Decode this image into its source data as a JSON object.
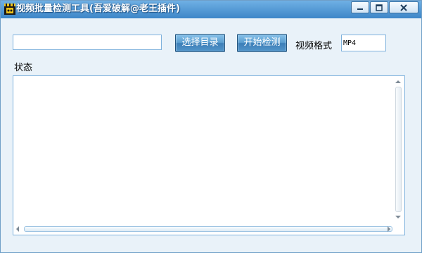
{
  "window": {
    "title": "视频批量检测工具(吾爱破解@老王插件)",
    "accent_color": "#3d86c8",
    "icon": "clapperboard-icon"
  },
  "toolbar": {
    "path_value": "",
    "select_dir_label": "选择目录",
    "start_label": "开始检测",
    "format_label": "视频格式",
    "format_value": "MP4"
  },
  "status": {
    "label": "状态",
    "log_text": ""
  }
}
